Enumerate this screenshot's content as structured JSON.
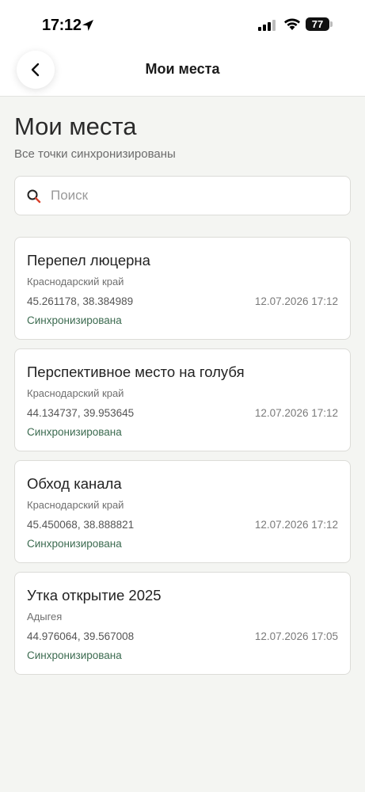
{
  "status_bar": {
    "time": "17:12",
    "battery": "77"
  },
  "header": {
    "title": "Мои места"
  },
  "page": {
    "title": "Мои места",
    "subtitle": "Все точки синхронизированы"
  },
  "search": {
    "placeholder": "Поиск",
    "value": ""
  },
  "places": [
    {
      "title": "Перепел люцерна",
      "region": "Краснодарский край",
      "coords": "45.261178, 38.384989",
      "date": "12.07.2026 17:12",
      "status": "Синхронизирована"
    },
    {
      "title": "Перспективное место на голубя",
      "region": "Краснодарский край",
      "coords": "44.134737, 39.953645",
      "date": "12.07.2026 17:12",
      "status": "Синхронизирована"
    },
    {
      "title": "Обход канала",
      "region": "Краснодарский край",
      "coords": "45.450068, 38.888821",
      "date": "12.07.2026 17:12",
      "status": "Синхронизирована"
    },
    {
      "title": "Утка открытие 2025",
      "region": "Адыгея",
      "coords": "44.976064, 39.567008",
      "date": "12.07.2026 17:05",
      "status": "Синхронизирована"
    }
  ],
  "colors": {
    "accent": "#3c6b50",
    "background": "#f4f5f2",
    "search_icon_accent": "#d9412b"
  }
}
